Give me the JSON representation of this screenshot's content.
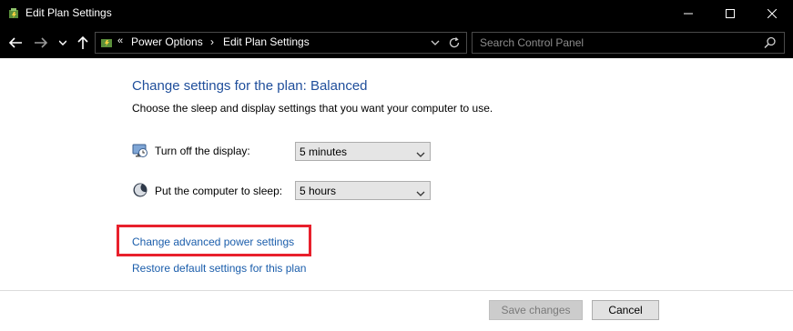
{
  "window": {
    "title": "Edit Plan Settings"
  },
  "nav": {
    "breadcrumb_chevron": "«",
    "breadcrumbs": [
      "Power Options",
      "Edit Plan Settings"
    ],
    "breadcrumb_separator": "›",
    "search_placeholder": "Search Control Panel"
  },
  "content": {
    "heading": "Change settings for the plan: Balanced",
    "subtext": "Choose the sleep and display settings that you want your computer to use.",
    "settings": [
      {
        "label": "Turn off the display:",
        "value": "5 minutes",
        "icon": "display-timer-icon"
      },
      {
        "label": "Put the computer to sleep:",
        "value": "5 hours",
        "icon": "sleep-moon-icon"
      }
    ],
    "links": {
      "advanced": "Change advanced power settings",
      "restore": "Restore default settings for this plan"
    }
  },
  "footer": {
    "save": "Save changes",
    "cancel": "Cancel"
  },
  "colors": {
    "link": "#1a5dab",
    "heading": "#1f4e9b",
    "highlight": "#e8202c",
    "titlebar": "#000000"
  }
}
